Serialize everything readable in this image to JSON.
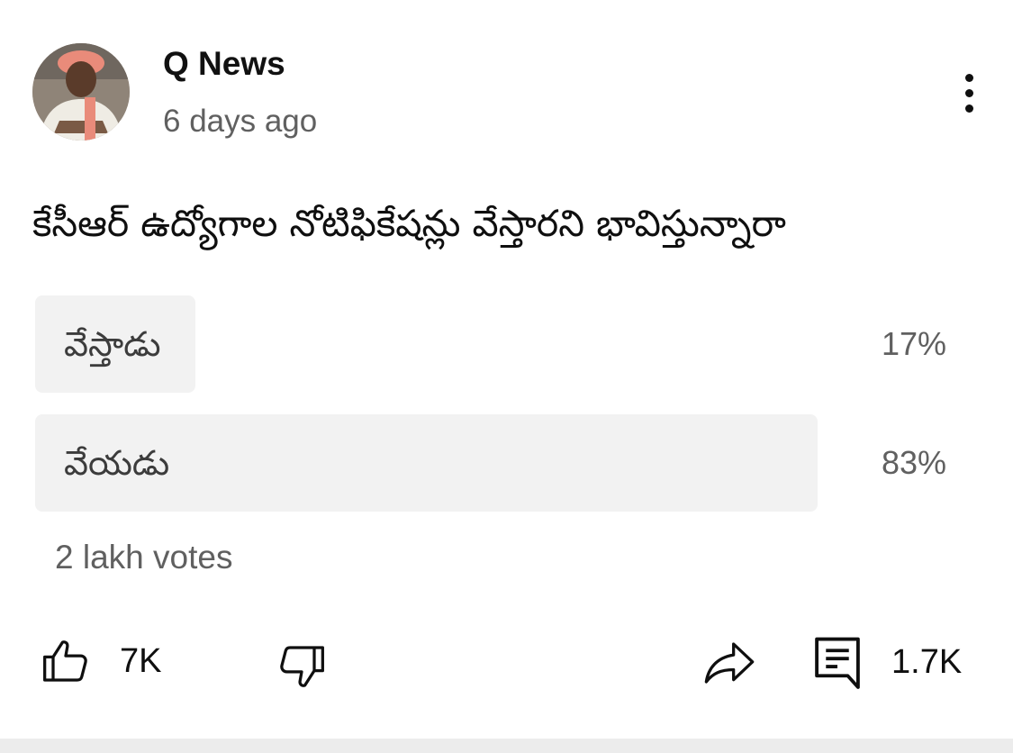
{
  "post": {
    "channel_name": "Q News",
    "timestamp": "6 days ago",
    "question": "కేసీఆర్ ఉద్యోగాల నోటిఫికేషన్లు వేస్తారని భావిస్తున్నారా"
  },
  "poll": {
    "options": [
      {
        "label": "వేస్తాడు",
        "percent_text": "17%",
        "percent": 17
      },
      {
        "label": "వేయడు",
        "percent_text": "83%",
        "percent": 83
      }
    ],
    "votes": "2 lakh votes"
  },
  "actions": {
    "likes": "7K",
    "comments": "1.7K"
  },
  "icons": [
    "more-vert-icon",
    "thumbs-up-icon",
    "thumbs-down-icon",
    "share-icon",
    "comment-icon"
  ]
}
